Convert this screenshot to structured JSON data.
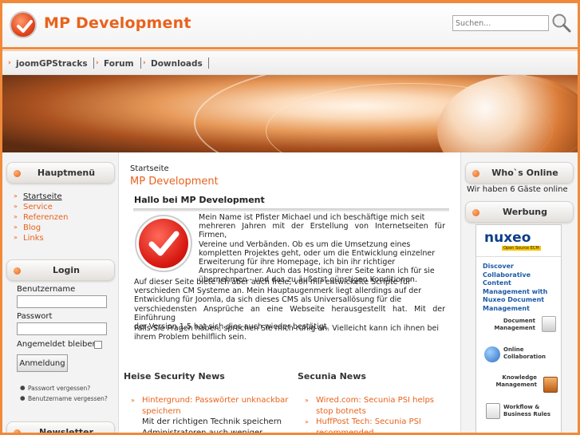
{
  "header": {
    "site_title": "MP Development",
    "search_placeholder": "Suchen...",
    "accent_color": "#e8621d"
  },
  "nav": {
    "items": [
      {
        "label": "joomGPStracks"
      },
      {
        "label": "Forum"
      },
      {
        "label": "Downloads"
      }
    ]
  },
  "left": {
    "main_menu": {
      "title": "Hauptmenü",
      "items": [
        {
          "label": "Startseite",
          "active": true
        },
        {
          "label": "Service"
        },
        {
          "label": "Referenzen"
        },
        {
          "label": "Blog"
        },
        {
          "label": "Links"
        }
      ]
    },
    "login": {
      "title": "Login",
      "username_label": "Benutzername",
      "password_label": "Passwort",
      "remember_label": "Angemeldet bleiben",
      "button_label": "Anmeldung",
      "forgot_password": "Passwort vergessen?",
      "forgot_username": "Benutzername vergessen?"
    },
    "newsletter": {
      "title": "Newsletter"
    }
  },
  "main": {
    "breadcrumb": "Startseite",
    "page_title": "MP Development",
    "article": {
      "title": "Hallo bei MP Development",
      "para1_lines": [
        "Mein Name ist Pfister Michael und ich beschäftige mich seit",
        "mehreren Jahren mit der Erstellung von Internetseiten für Firmen,",
        "Vereine und Verbänden. Ob es um die Umsetzung eines",
        "kompletten Projektes geht, oder um die Entwicklung einzelner",
        "Erweiterung für ihre Homepage, ich bin ihr richtiger",
        "Ansprechpartner. Auch das Hosting ihrer Seite kann ich für sie",
        "übernehmen - und das zu äußerst günstigen Konditionen."
      ],
      "para2_lines": [
        "Auf dieser Seite biete ich aber auch freie, von mir entwickelte Scripte für",
        "verschieden CM Systeme an. Mein Hauptaugenmerk liegt allerdings auf der",
        "Entwicklung für Joomla, da sich dieses CMS als Universallösung für die",
        "verschiedensten Ansprüche an eine Webseite herausgestellt hat. Mit der Einführung",
        "der Version 1.5 hat sich dies auch wieder bestätigt."
      ],
      "para3_lines": [
        "Falls Sie Fragen haben, sprechen Sie mich ruhig an. Vielleicht kann ich ihnen bei",
        "ihrem Problem behilflich sein."
      ]
    },
    "news_left": {
      "title": "Heise Security News",
      "items": [
        {
          "label": "Hintergrund: Passwörter unknackbar speichern",
          "desc": "Mit der richtigen Technik speichern Administratoren auch weniger"
        }
      ]
    },
    "news_right": {
      "title": "Secunia News",
      "items": [
        {
          "label": "Wired.com: Secunia PSI helps stop botnets"
        },
        {
          "label": "HuffPost Tech: Secunia PSI recommended"
        }
      ]
    }
  },
  "right": {
    "online": {
      "title": "Who`s Online",
      "text": "Wir haben 6 Gäste online"
    },
    "ads": {
      "title": "Werbung",
      "brand": "nuxeo",
      "brand_sub": "Open Source ECM",
      "headline": "Discover Collaborative Content Management with Nuxeo Document Management",
      "items": [
        {
          "label": "Document Management"
        },
        {
          "label": "Online Collaboration"
        },
        {
          "label": "Knowledge Management"
        },
        {
          "label": "Workflow & Business Rules"
        }
      ]
    }
  }
}
